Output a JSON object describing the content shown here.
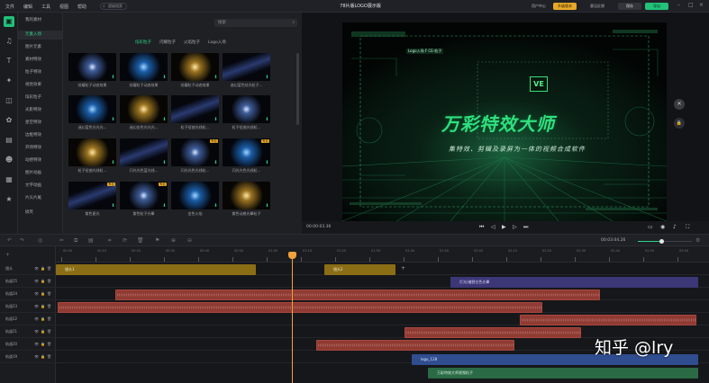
{
  "menu": [
    "文件",
    "编辑",
    "工具",
    "视图",
    "帮助"
  ],
  "search_placeholder": "超级搜索",
  "document_title": "78片版LOGO展示版",
  "toolbar": {
    "user_center": "用户中心",
    "upgrade": "升级版本",
    "feedback": "意见反馈",
    "save": "保存",
    "export": "导出"
  },
  "rail_icons": [
    "media-icon",
    "music-icon",
    "text-icon",
    "effect-icon",
    "filter-icon",
    "element-icon",
    "folder-icon",
    "user-icon",
    "template-icon",
    "star-icon"
  ],
  "categories": [
    "我的素材",
    "元素入场",
    "图片元素",
    "素材特效",
    "粒子特效",
    "视觉效果",
    "炫彩粒子",
    "光影特效",
    "星空特效",
    "边框特效",
    "开场特效",
    "动感特效",
    "图片动画",
    "文字动画",
    "片头片尾",
    "搞笑"
  ],
  "asset_search_placeholder": "搜索",
  "filter_tabs": [
    "炫彩粒子",
    "闪耀粒子",
    "火焰粒子",
    "Logo入场"
  ],
  "thumbs": [
    {
      "label": "炫耀粒子动态效果",
      "pro": false
    },
    {
      "label": "炫耀粒子动态效果",
      "pro": false
    },
    {
      "label": "炫耀粒子动态效果",
      "pro": false
    },
    {
      "label": "迷幻蓝色炫光粒子...",
      "pro": false
    },
    {
      "label": "迷幻蓝色光光光...",
      "pro": false
    },
    {
      "label": "迷幻金色光光光...",
      "pro": false
    },
    {
      "label": "粒子扭曲光线粒...",
      "pro": false
    },
    {
      "label": "粒子扭曲光线粒...",
      "pro": false
    },
    {
      "label": "粒子扭曲光线粒...",
      "pro": false
    },
    {
      "label": "闪光光色蓝光线...",
      "pro": false
    },
    {
      "label": "闪光光色光线粒...",
      "pro": true
    },
    {
      "label": "闪光光色光线粒...",
      "pro": true
    },
    {
      "label": "紫色星光",
      "pro": true
    },
    {
      "label": "紫色粒子光晕",
      "pro": true
    },
    {
      "label": "金色火焰",
      "pro": false
    },
    {
      "label": "紫色动感光晕粒子",
      "pro": false
    }
  ],
  "preview": {
    "layer_tag": "Logo入场 F CE-粒子",
    "logo_text": "VE",
    "title": "万彩特效大师",
    "subtitle": "集特效、剪辑及录屏为一体的视频合成软件",
    "time_current": "00:00:03.36",
    "time_total": "00:00:04.26"
  },
  "timeline": {
    "time": "00:03:04.26",
    "ruler_labels": [
      "00:00",
      "00:10",
      "00:20",
      "00:30",
      "00:40",
      "00:50",
      "01:00",
      "01:10",
      "01:20",
      "01:30",
      "01:40",
      "01:50",
      "02:00",
      "02:10",
      "02:20",
      "02:30",
      "02:40",
      "02:50",
      "03:00"
    ],
    "tracks": [
      "镜头",
      "轨道25",
      "轨道24",
      "轨道23",
      "轨道22",
      "轨道21",
      "轨道20",
      "轨道19"
    ],
    "clips": {
      "shot1": "镜头1",
      "shot2": "镜头2",
      "text1": "灯光/遍野白色光晕",
      "logo": "logo_128",
      "text2": "万彩特效大师视频粒子"
    }
  },
  "watermark": "知乎 @lry",
  "colors": {
    "accent": "#2fd08a",
    "shot_clip": "#8a6d15",
    "audio_clip": "#8f3b33",
    "text_clip": "#3c3777",
    "logo_clip": "#2f4d8f",
    "playhead": "#f0a23c"
  }
}
